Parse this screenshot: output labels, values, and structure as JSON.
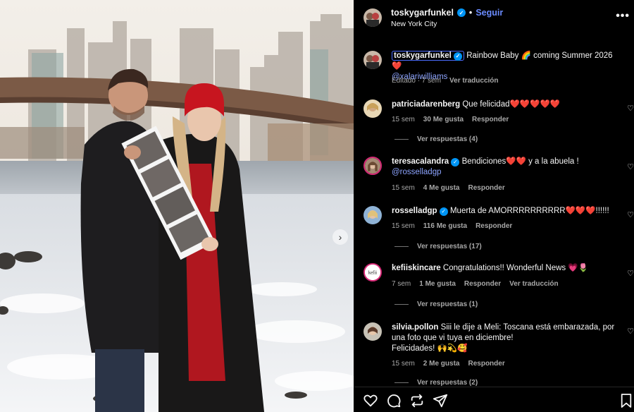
{
  "post": {
    "next_icon": "chevron-right-icon"
  },
  "header": {
    "username": "toskygarfunkel",
    "follow_label": "Seguir",
    "location": "New York City",
    "separator": "•"
  },
  "caption": {
    "username": "toskygarfunkel",
    "text": "Rainbow Baby 🌈 coming Summer 2026 ❤️",
    "mention": "@xalariwilliams",
    "time": "Editado · 7 sem",
    "translate": "Ver traducción"
  },
  "comments": [
    {
      "username": "patriciadarenberg",
      "verified": false,
      "text": "Que felicidad❤️❤️❤️❤️❤️",
      "time": "15 sem",
      "likes": "30 Me gusta",
      "reply": "Responder",
      "view_replies": "Ver respuestas (4)"
    },
    {
      "username": "teresacalandra",
      "verified": true,
      "text": "Bendiciones❤️❤️ y a la abuela !",
      "mention": "@rosselladgp",
      "time": "15 sem",
      "likes": "4 Me gusta",
      "reply": "Responder"
    },
    {
      "username": "rosselladgp",
      "verified": true,
      "text": "Muerta de AMORRRRRRRRRR❤️❤️❤️!!!!!!",
      "time": "15 sem",
      "likes": "116 Me gusta",
      "reply": "Responder",
      "view_replies": "Ver respuestas (17)"
    },
    {
      "username": "kefiiskincare",
      "verified": false,
      "text": "Congratulations!! Wonderful News 💗🌷",
      "time": "7 sem",
      "likes": "1 Me gusta",
      "reply": "Responder",
      "translate": "Ver traducción",
      "view_replies": "Ver respuestas (1)"
    },
    {
      "username": "silvia.pollon",
      "verified": false,
      "text": "Siii le dije a Meli: Toscana está embarazada, por una foto que vi tuya en diciembre!",
      "text2": "Felicidades! 🙌💫🥰",
      "time": "15 sem",
      "likes": "2 Me gusta",
      "reply": "Responder",
      "view_replies": "Ver respuestas (2)"
    }
  ],
  "actions": {
    "like_icon": "heart-icon",
    "comment_icon": "comment-icon",
    "share_icon": "repost-icon",
    "send_icon": "send-icon",
    "save_icon": "bookmark-icon",
    "more_icon": "more-horizontal-icon"
  },
  "colors": {
    "accent": "#0095f6",
    "follow": "#6b8cff",
    "background": "#000000",
    "muted": "#a8a8a8"
  }
}
